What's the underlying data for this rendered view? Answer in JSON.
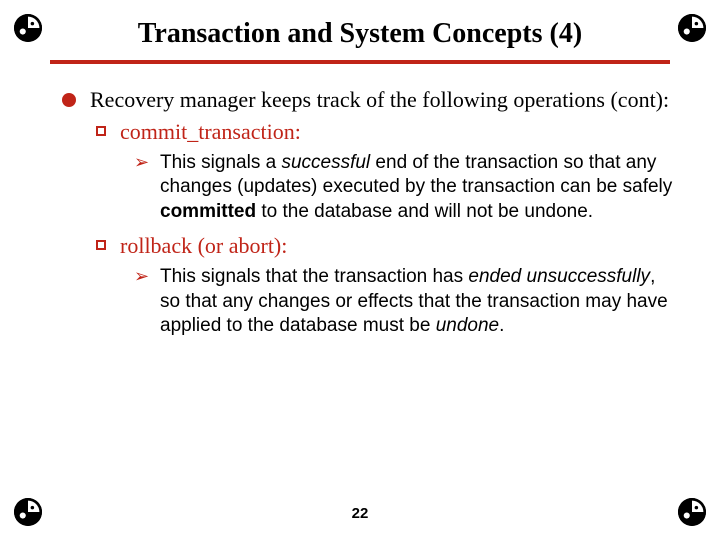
{
  "title": "Transaction and System Concepts (4)",
  "page_number": "22",
  "accent_color": "#c02418",
  "body": {
    "intro": "Recovery manager keeps track of the following operations (cont):",
    "items": [
      {
        "name": "commit_transaction:",
        "desc_pre": "This signals a ",
        "desc_em1": "successful",
        "desc_mid": " end of the transaction so that any changes (updates) executed by the transaction can be safely ",
        "desc_bold": "committed",
        "desc_post": " to the database and will not be undone."
      },
      {
        "name": "rollback (or abort):",
        "desc_pre": "This signals that the transaction has ",
        "desc_em1": "ended unsuccessfully",
        "desc_mid": ", so that any changes or effects that the transaction may have applied to the database must be ",
        "desc_em2": "undone",
        "desc_post": "."
      }
    ]
  }
}
